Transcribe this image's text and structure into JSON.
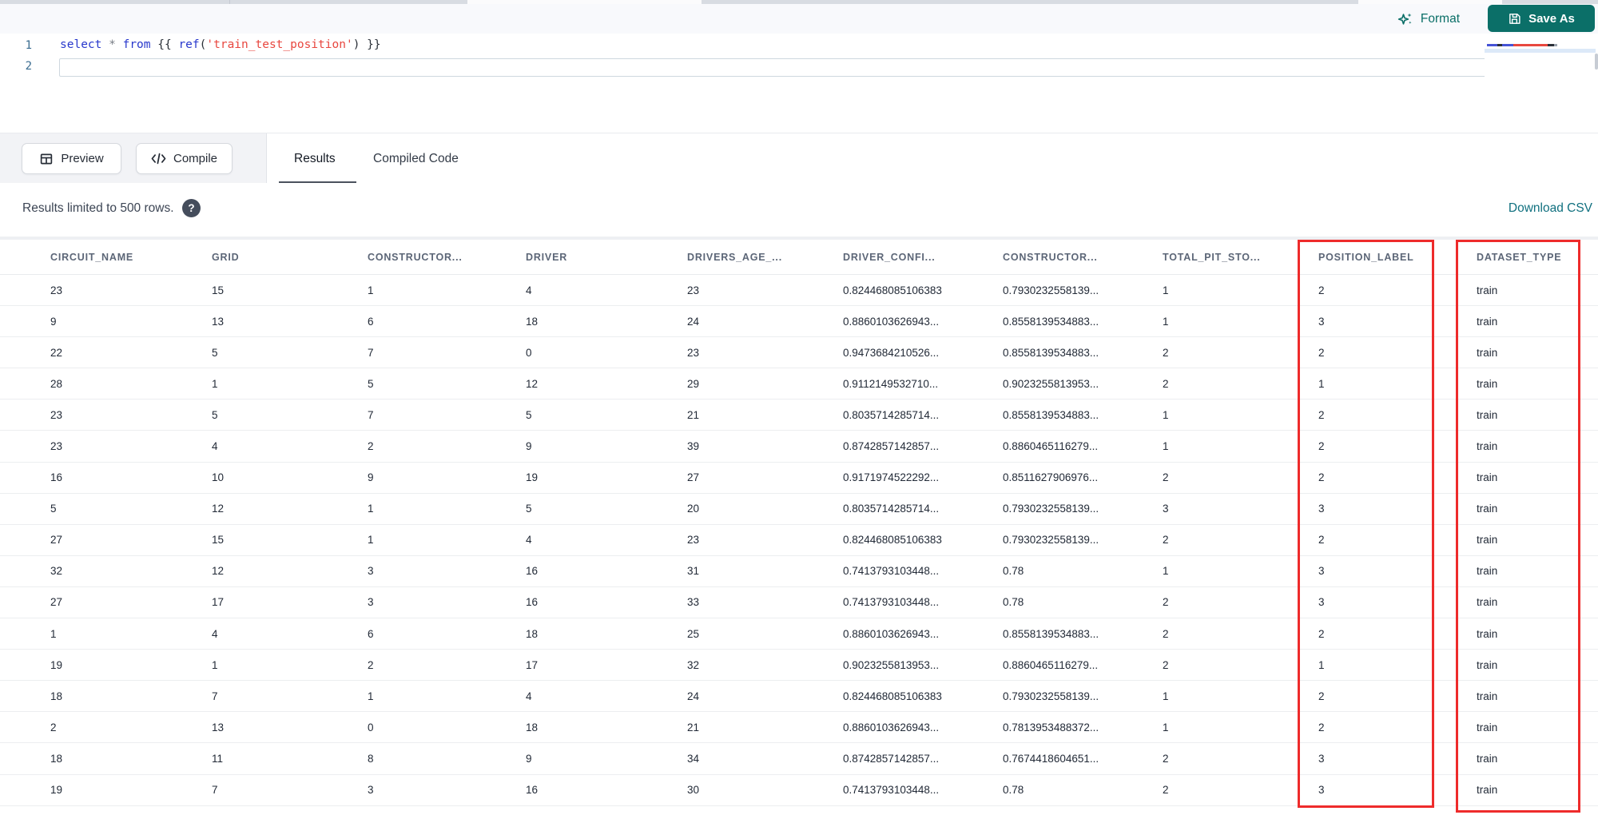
{
  "toolbar": {
    "format_label": "Format",
    "save_as_label": "Save As"
  },
  "editor": {
    "lines": [
      {
        "number": "1",
        "tokens": [
          {
            "t": "select",
            "c": "kw"
          },
          {
            "t": " ",
            "c": "pl"
          },
          {
            "t": "*",
            "c": "op"
          },
          {
            "t": " ",
            "c": "pl"
          },
          {
            "t": "from",
            "c": "kw"
          },
          {
            "t": " {{ ",
            "c": "pl"
          },
          {
            "t": "ref",
            "c": "fn"
          },
          {
            "t": "(",
            "c": "pl"
          },
          {
            "t": "'train_test_position'",
            "c": "str"
          },
          {
            "t": ") }}",
            "c": "pl"
          }
        ]
      },
      {
        "number": "2",
        "tokens": []
      }
    ]
  },
  "actions": {
    "preview_label": "Preview",
    "compile_label": "Compile"
  },
  "tabs": [
    {
      "label": "Results",
      "active": true
    },
    {
      "label": "Compiled Code",
      "active": false
    }
  ],
  "results": {
    "limit_notice": "Results limited to 500 rows.",
    "help_glyph": "?",
    "download_csv_label": "Download CSV"
  },
  "table": {
    "columns": [
      "CIRCUIT_NAME",
      "GRID",
      "CONSTRUCTOR...",
      "DRIVER",
      "DRIVERS_AGE_...",
      "DRIVER_CONFI...",
      "CONSTRUCTOR...",
      "TOTAL_PIT_STO...",
      "POSITION_LABEL",
      "DATASET_TYPE"
    ],
    "highlighted_columns": [
      "POSITION_LABEL",
      "DATASET_TYPE"
    ],
    "rows": [
      [
        "23",
        "15",
        "1",
        "4",
        "23",
        "0.824468085106383",
        "0.7930232558139...",
        "1",
        "2",
        "train"
      ],
      [
        "9",
        "13",
        "6",
        "18",
        "24",
        "0.8860103626943...",
        "0.8558139534883...",
        "1",
        "3",
        "train"
      ],
      [
        "22",
        "5",
        "7",
        "0",
        "23",
        "0.9473684210526...",
        "0.8558139534883...",
        "2",
        "2",
        "train"
      ],
      [
        "28",
        "1",
        "5",
        "12",
        "29",
        "0.9112149532710...",
        "0.9023255813953...",
        "2",
        "1",
        "train"
      ],
      [
        "23",
        "5",
        "7",
        "5",
        "21",
        "0.8035714285714...",
        "0.8558139534883...",
        "1",
        "2",
        "train"
      ],
      [
        "23",
        "4",
        "2",
        "9",
        "39",
        "0.8742857142857...",
        "0.8860465116279...",
        "1",
        "2",
        "train"
      ],
      [
        "16",
        "10",
        "9",
        "19",
        "27",
        "0.9171974522292...",
        "0.8511627906976...",
        "2",
        "2",
        "train"
      ],
      [
        "5",
        "12",
        "1",
        "5",
        "20",
        "0.8035714285714...",
        "0.7930232558139...",
        "3",
        "3",
        "train"
      ],
      [
        "27",
        "15",
        "1",
        "4",
        "23",
        "0.824468085106383",
        "0.7930232558139...",
        "2",
        "2",
        "train"
      ],
      [
        "32",
        "12",
        "3",
        "16",
        "31",
        "0.7413793103448...",
        "0.78",
        "1",
        "3",
        "train"
      ],
      [
        "27",
        "17",
        "3",
        "16",
        "33",
        "0.7413793103448...",
        "0.78",
        "2",
        "3",
        "train"
      ],
      [
        "1",
        "4",
        "6",
        "18",
        "25",
        "0.8860103626943...",
        "0.8558139534883...",
        "2",
        "2",
        "train"
      ],
      [
        "19",
        "1",
        "2",
        "17",
        "32",
        "0.9023255813953...",
        "0.8860465116279...",
        "2",
        "1",
        "train"
      ],
      [
        "18",
        "7",
        "1",
        "4",
        "24",
        "0.824468085106383",
        "0.7930232558139...",
        "1",
        "2",
        "train"
      ],
      [
        "2",
        "13",
        "0",
        "18",
        "21",
        "0.8860103626943...",
        "0.7813953488372...",
        "1",
        "2",
        "train"
      ],
      [
        "18",
        "11",
        "8",
        "9",
        "34",
        "0.8742857142857...",
        "0.7674418604651...",
        "2",
        "3",
        "train"
      ],
      [
        "19",
        "7",
        "3",
        "16",
        "30",
        "0.7413793103448...",
        "0.78",
        "2",
        "3",
        "train"
      ]
    ]
  },
  "colors": {
    "accent_teal": "#0b6f68",
    "link_teal": "#10707f",
    "highlight_red": "#ee2b2b",
    "keyword_blue": "#2838cc",
    "string_red": "#e8473f"
  }
}
